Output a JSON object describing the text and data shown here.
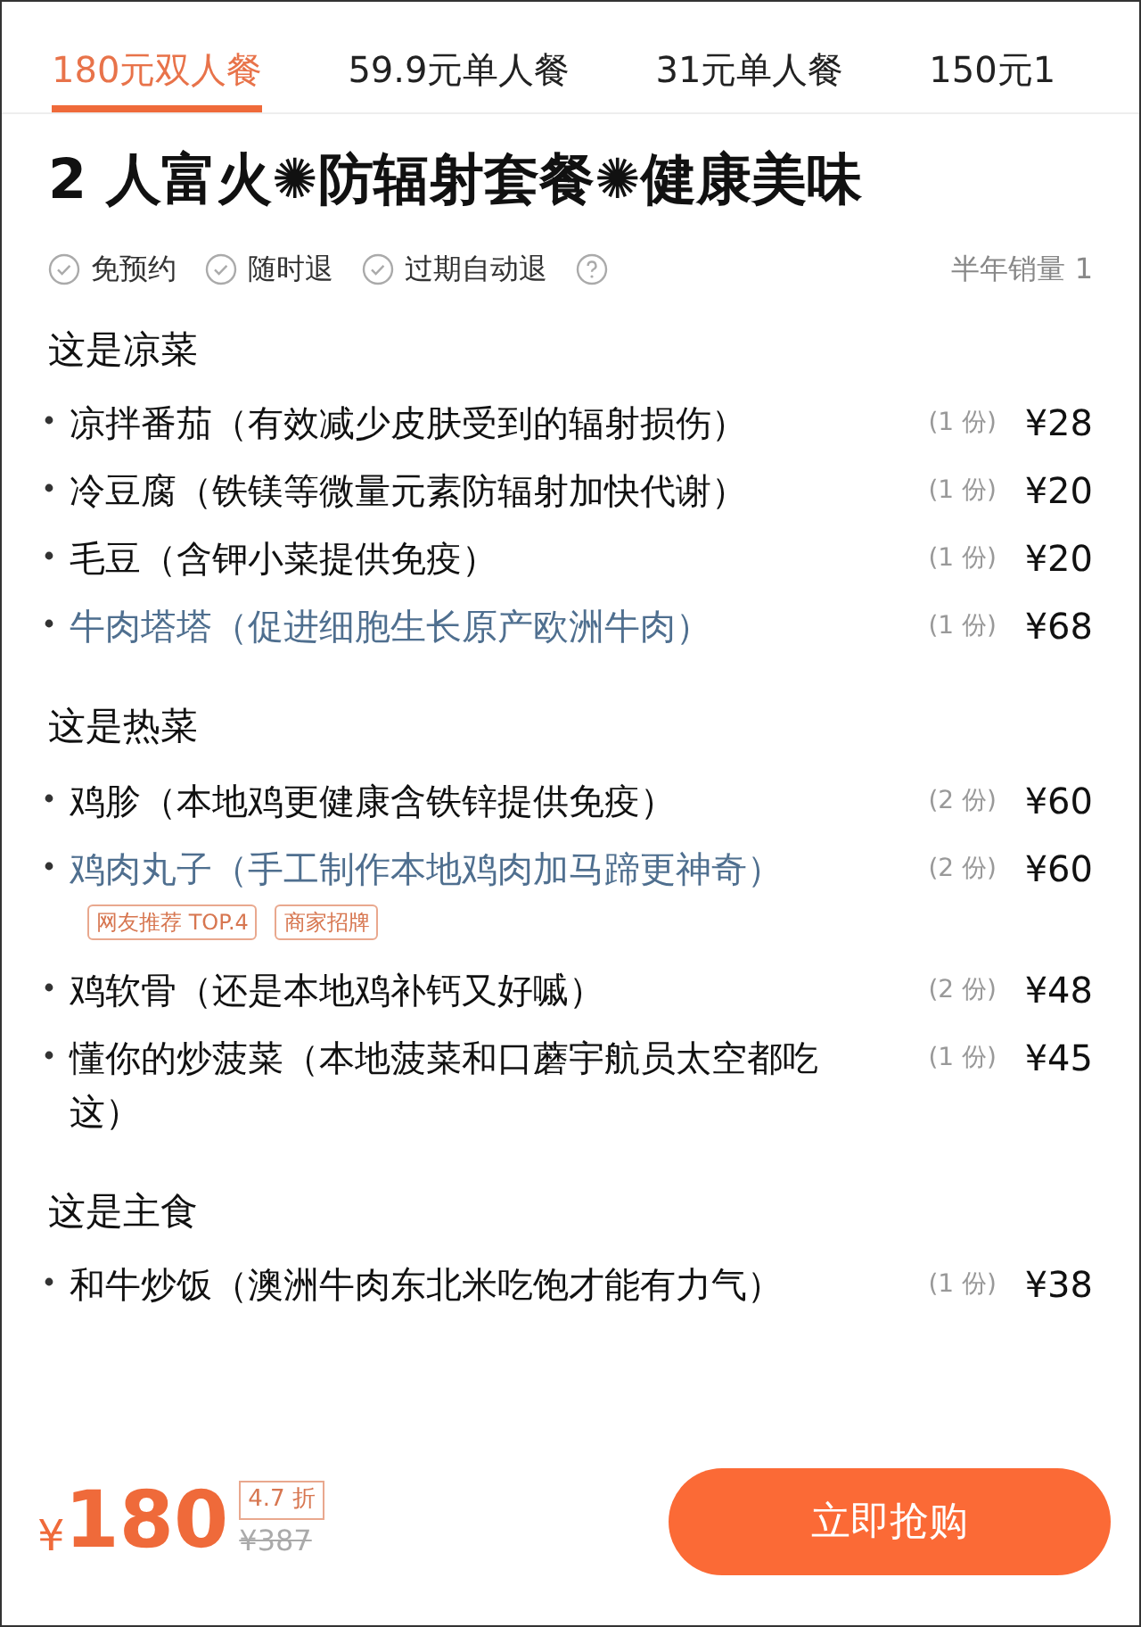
{
  "tabs": [
    {
      "label": "180元双人餐",
      "selected": true
    },
    {
      "label": "59.9元单人餐",
      "selected": false
    },
    {
      "label": "31元单人餐",
      "selected": false
    },
    {
      "label": "150元1",
      "selected": false
    }
  ],
  "title": "2 人富火✺防辐射套餐✺健康美味",
  "features": [
    "免预约",
    "随时退",
    "过期自动退"
  ],
  "sales": "半年销量 1",
  "sections": [
    {
      "heading": "这是凉菜",
      "items": [
        {
          "name": "凉拌番茄（有效减少皮肤受到的辐射损伤）",
          "highlighted": false,
          "qty": "(1 份)",
          "price": "¥28"
        },
        {
          "name": "冷豆腐（铁镁等微量元素防辐射加快代谢）",
          "highlighted": false,
          "qty": "(1 份)",
          "price": "¥20"
        },
        {
          "name": "毛豆（含钾小菜提供免疫）",
          "highlighted": false,
          "qty": "(1 份)",
          "price": "¥20"
        },
        {
          "name": "牛肉塔塔（促进细胞生长原产欧洲牛肉）",
          "highlighted": true,
          "qty": "(1 份)",
          "price": "¥68"
        }
      ]
    },
    {
      "heading": "这是热菜",
      "items": [
        {
          "name": "鸡胗（本地鸡更健康含铁锌提供免疫）",
          "highlighted": false,
          "qty": "(2 份)",
          "price": "¥60"
        },
        {
          "name": "鸡肉丸子（手工制作本地鸡肉加马蹄更神奇）",
          "highlighted": true,
          "qty": "(2 份)",
          "price": "¥60",
          "tags": [
            "网友推荐 TOP.4",
            "商家招牌"
          ]
        },
        {
          "name": "鸡软骨（还是本地鸡补钙又好嘁）",
          "highlighted": false,
          "qty": "(2 份)",
          "price": "¥48"
        },
        {
          "name": "懂你的炒菠菜（本地菠菜和口蘑宇航员太空都吃这）",
          "highlighted": false,
          "qty": "(1 份)",
          "price": "¥45"
        }
      ]
    },
    {
      "heading": "这是主食",
      "items": [
        {
          "name": "和牛炒饭（澳洲牛肉东北米吃饱才能有力气）",
          "highlighted": false,
          "qty": "(1 份)",
          "price": "¥38"
        }
      ]
    }
  ],
  "footer": {
    "currency": "¥",
    "price": "180",
    "discount": "4.7 折",
    "original_price": "¥387",
    "button": "立即抢购"
  }
}
